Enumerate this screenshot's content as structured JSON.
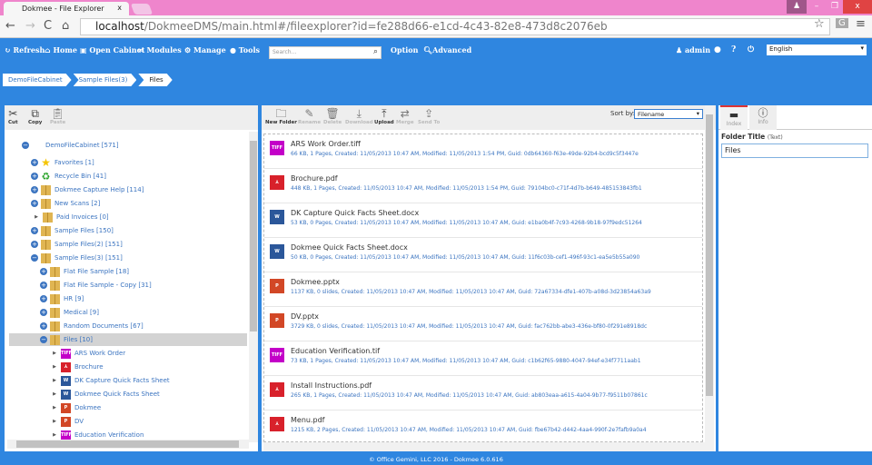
{
  "browser": {
    "tab_title": "Dokmee - File Explorer",
    "tab_close": "x",
    "url_host": "localhost",
    "url_path": "/DokmeeDMS/main.html#/fileexplorer?id=fe288d66-e1cd-4c43-82e8-473d8c2076eb"
  },
  "nav": {
    "refresh": "Refresh",
    "home": "Home",
    "open_cabinet": "Open Cabinet",
    "modules": "Modules",
    "manage": "Manage",
    "tools": "Tools",
    "search_placeholder": "Search...",
    "option": "Option",
    "advanced": "Advanced",
    "user": "admin",
    "language": "English"
  },
  "breadcrumb": [
    "DemoFileCabinet",
    "Sample Files(3)",
    "Files"
  ],
  "left_toolbar": {
    "cut": "Cut",
    "copy": "Copy",
    "paste": "Paste"
  },
  "tree": [
    {
      "label": "DemoFileCabinet [571]",
      "level": 0,
      "toggle": "minus",
      "icon": "cabinet"
    },
    {
      "label": "Favorites [1]",
      "level": 1,
      "toggle": "plus",
      "icon": "star"
    },
    {
      "label": "Recycle Bin [41]",
      "level": 1,
      "toggle": "plus",
      "icon": "recycle"
    },
    {
      "label": "Dokmee Capture Help [114]",
      "level": 1,
      "toggle": "plus",
      "icon": "folder"
    },
    {
      "label": "New Scans [2]",
      "level": 1,
      "toggle": "plus",
      "icon": "folder"
    },
    {
      "label": "Paid Invoices [0]",
      "level": 1,
      "toggle": "arrow",
      "icon": "folder"
    },
    {
      "label": "Sample Files [150]",
      "level": 1,
      "toggle": "plus",
      "icon": "folder"
    },
    {
      "label": "Sample Files(2) [151]",
      "level": 1,
      "toggle": "plus",
      "icon": "folder"
    },
    {
      "label": "Sample Files(3) [151]",
      "level": 1,
      "toggle": "minus",
      "icon": "folder"
    },
    {
      "label": "Flat File Sample [18]",
      "level": 2,
      "toggle": "plus",
      "icon": "folder"
    },
    {
      "label": "Flat File Sample - Copy [31]",
      "level": 2,
      "toggle": "plus",
      "icon": "folder"
    },
    {
      "label": "HR [9]",
      "level": 2,
      "toggle": "plus",
      "icon": "folder"
    },
    {
      "label": "Medical [9]",
      "level": 2,
      "toggle": "plus",
      "icon": "folder"
    },
    {
      "label": "Random Documents [67]",
      "level": 2,
      "toggle": "plus",
      "icon": "folder"
    },
    {
      "label": "Files [10]",
      "level": 2,
      "toggle": "minus",
      "icon": "folder",
      "selected": true
    },
    {
      "label": "ARS Work Order",
      "level": 3,
      "toggle": "arrow",
      "icon": "tiff"
    },
    {
      "label": "Brochure",
      "level": 3,
      "toggle": "arrow",
      "icon": "pdf"
    },
    {
      "label": "DK Capture Quick Facts Sheet",
      "level": 3,
      "toggle": "arrow",
      "icon": "doc"
    },
    {
      "label": "Dokmee Quick Facts Sheet",
      "level": 3,
      "toggle": "arrow",
      "icon": "doc"
    },
    {
      "label": "Dokmee",
      "level": 3,
      "toggle": "arrow",
      "icon": "ppt"
    },
    {
      "label": "DV",
      "level": 3,
      "toggle": "arrow",
      "icon": "ppt"
    },
    {
      "label": "Education Verification",
      "level": 3,
      "toggle": "arrow",
      "icon": "tiff"
    }
  ],
  "mid_toolbar": [
    {
      "label": "New Folder",
      "icon": "folder-open-icon",
      "enabled": true
    },
    {
      "label": "Rename",
      "icon": "pencil-icon",
      "enabled": false
    },
    {
      "label": "Delete",
      "icon": "trash-icon",
      "enabled": false
    },
    {
      "label": "Download",
      "icon": "download-icon",
      "enabled": false
    },
    {
      "label": "Upload",
      "icon": "upload-icon",
      "enabled": true
    },
    {
      "label": "Merge",
      "icon": "merge-icon",
      "enabled": false
    },
    {
      "label": "Send To",
      "icon": "share-icon",
      "enabled": false
    }
  ],
  "sort": {
    "label": "Sort by:",
    "value": "Filename"
  },
  "files": [
    {
      "name": "ARS Work Order.tiff",
      "type": "tiff",
      "details": "66 KB, 1 Pages, Created: 11/05/2013 10:47 AM, Modified: 11/05/2013 1:54 PM, Guid: 0db64360-f63e-49de-92b4-bcd9c5f3447e"
    },
    {
      "name": "Brochure.pdf",
      "type": "pdf",
      "details": "448 KB, 1 Pages, Created: 11/05/2013 10:47 AM, Modified: 11/05/2013 1:54 PM, Guid: 79104bc0-c71f-4d7b-b649-485153843fb1"
    },
    {
      "name": "DK Capture Quick Facts Sheet.docx",
      "type": "doc",
      "details": "53 KB, 0 Pages, Created: 11/05/2013 10:47 AM, Modified: 11/05/2013 10:47 AM, Guid: e1ba0b4f-7c93-4268-9b18-97f9edc51264"
    },
    {
      "name": "Dokmee Quick Facts Sheet.docx",
      "type": "doc",
      "details": "50 KB, 0 Pages, Created: 11/05/2013 10:47 AM, Modified: 11/05/2013 10:47 AM, Guid: 11f6c03b-cef1-496f-93c1-ea5e5b55a090"
    },
    {
      "name": "Dokmee.pptx",
      "type": "ppt",
      "details": "1137 KB, 0 slides, Created: 11/05/2013 10:47 AM, Modified: 11/05/2013 10:47 AM, Guid: 72a67334-dfe1-407b-a08d-3d23854a63a9"
    },
    {
      "name": "DV.pptx",
      "type": "ppt",
      "details": "3729 KB, 0 slides, Created: 11/05/2013 10:47 AM, Modified: 11/05/2013 10:47 AM, Guid: fac762bb-abe3-436e-bf80-0f291e8918dc"
    },
    {
      "name": "Education Verification.tif",
      "type": "tiff",
      "details": "73 KB, 1 Pages, Created: 11/05/2013 10:47 AM, Modified: 11/05/2013 10:47 AM, Guid: c1b62f65-9880-4047-94ef-e34f7711aab1"
    },
    {
      "name": "Install Instructions.pdf",
      "type": "pdf",
      "details": "265 KB, 1 Pages, Created: 11/05/2013 10:47 AM, Modified: 11/05/2013 10:47 AM, Guid: ab803eaa-a615-4a04-9b77-f9511b07861c"
    },
    {
      "name": "Menu.pdf",
      "type": "pdf",
      "details": "1215 KB, 2 Pages, Created: 11/05/2013 10:47 AM, Modified: 11/05/2013 10:47 AM, Guid: fbe67b42-d442-4aa4-990f-2e7fafb9a0a4"
    }
  ],
  "type_badges": {
    "tiff": "TIFF",
    "pdf": "⅄",
    "doc": "W",
    "ppt": "P"
  },
  "right": {
    "tab_index": "Index",
    "tab_info": "Info",
    "field_label": "Folder Title",
    "field_type": "(Text)",
    "field_value": "Files"
  },
  "footer": "© Office Gemini, LLC 2016 - Dokmee 6.0.616",
  "colors": {
    "accent": "#2f86e0",
    "titlebar": "#ef85cc",
    "link": "#3b74c0"
  }
}
